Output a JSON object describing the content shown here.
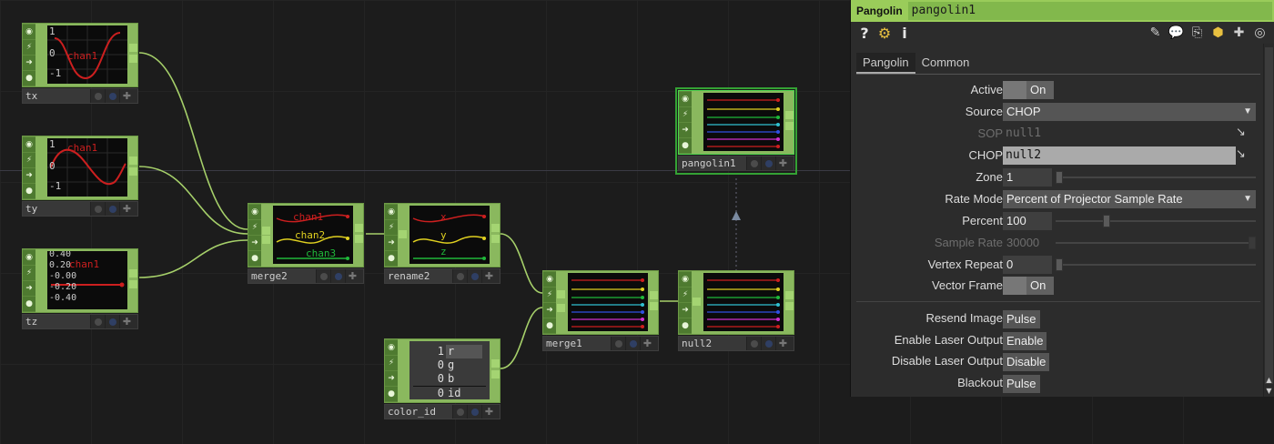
{
  "nodes": {
    "tx": {
      "name": "tx",
      "label": "chan1",
      "ticks": [
        "1",
        "0",
        "-1"
      ]
    },
    "ty": {
      "name": "ty",
      "label": "chan1",
      "ticks": [
        "1",
        "0",
        "-1"
      ]
    },
    "tz": {
      "name": "tz",
      "label": "chan1",
      "ticks": [
        "0.40",
        "0.20",
        "-0.00",
        "-0.20",
        "-0.40"
      ]
    },
    "merge2": {
      "name": "merge2",
      "labels": [
        "chan1",
        "chan2",
        "chan3"
      ]
    },
    "rename2": {
      "name": "rename2",
      "labels": [
        "x",
        "y",
        "z"
      ]
    },
    "merge1": {
      "name": "merge1"
    },
    "null2": {
      "name": "null2"
    },
    "pangolin1": {
      "name": "pangolin1"
    },
    "color_id": {
      "name": "color_id",
      "rows": [
        {
          "v": "1",
          "c": "r"
        },
        {
          "v": "0",
          "c": "g"
        },
        {
          "v": "0",
          "c": "b"
        },
        {
          "v": "0",
          "c": "id"
        }
      ]
    }
  },
  "panel": {
    "op_type": "Pangolin",
    "op_name": "pangolin1",
    "toolbar_left": [
      "?",
      "i"
    ],
    "tabs": [
      "Pangolin",
      "Common"
    ],
    "params": {
      "active": {
        "label": "Active",
        "value": "On"
      },
      "source": {
        "label": "Source",
        "value": "CHOP"
      },
      "sop": {
        "label": "SOP",
        "value": "null1"
      },
      "chop": {
        "label": "CHOP",
        "value": "null2"
      },
      "zone": {
        "label": "Zone",
        "value": "1"
      },
      "rate_mode": {
        "label": "Rate Mode",
        "value": "Percent of Projector Sample Rate"
      },
      "percent": {
        "label": "Percent",
        "value": "100"
      },
      "sample_rate": {
        "label": "Sample Rate",
        "value": "30000"
      },
      "vertex_repeat": {
        "label": "Vertex Repeat",
        "value": "0"
      },
      "vector_frame": {
        "label": "Vector Frame",
        "value": "On"
      },
      "resend_image": {
        "label": "Resend Image",
        "value": "Pulse"
      },
      "enable_laser": {
        "label": "Enable Laser Output",
        "value": "Enable"
      },
      "disable_laser": {
        "label": "Disable Laser Output",
        "value": "Disable"
      },
      "blackout": {
        "label": "Blackout",
        "value": "Pulse"
      }
    }
  },
  "colors": {
    "node_green": "#8ab85e",
    "wire": "#a6d06a",
    "header": "#9acc5a"
  }
}
